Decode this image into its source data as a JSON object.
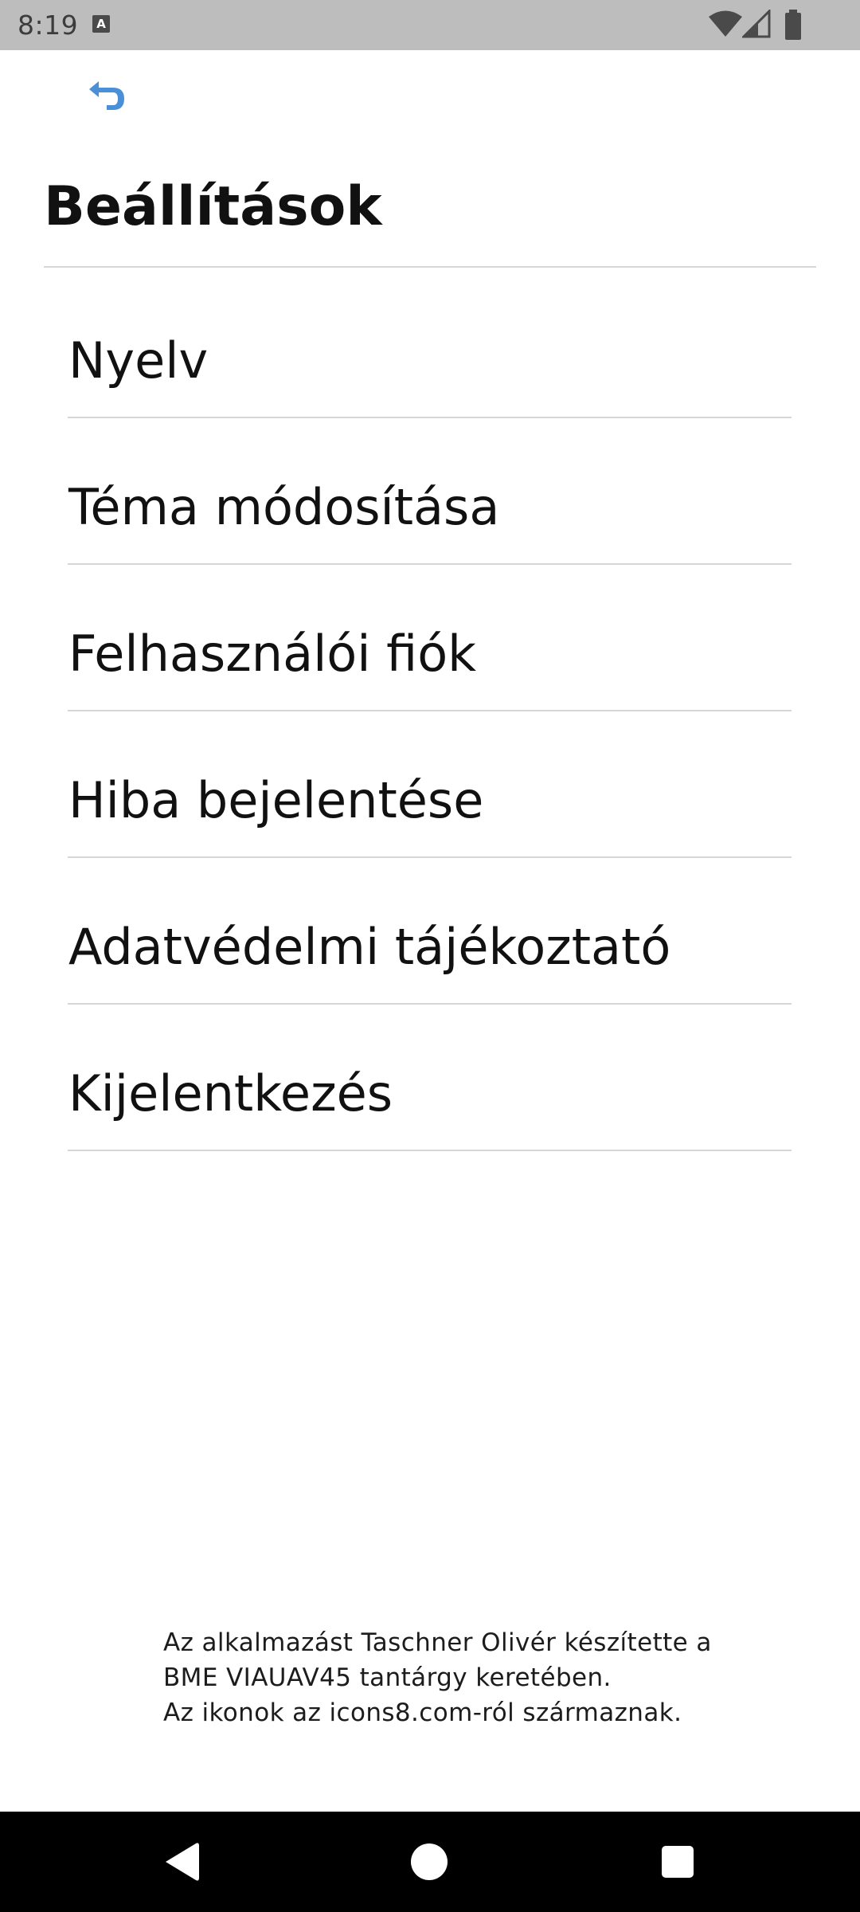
{
  "status_bar": {
    "time": "8:19",
    "notification_icon": "A",
    "icons": [
      "wifi-icon",
      "cellular-signal-icon",
      "battery-icon"
    ]
  },
  "header": {
    "back_icon": "undo-arrow-icon",
    "title": "Beállítások"
  },
  "menu": {
    "items": [
      {
        "label": "Nyelv"
      },
      {
        "label": "Téma módosítása"
      },
      {
        "label": "Felhasználói fiók"
      },
      {
        "label": "Hiba bejelentése"
      },
      {
        "label": "Adatvédelmi tájékoztató"
      },
      {
        "label": "Kijelentkezés"
      }
    ]
  },
  "footer": {
    "line1": "Az alkalmazást Taschner Olivér készítette a",
    "line2": "BME VIAUAV45 tantárgy keretében.",
    "line3": "Az ikonok az icons8.com-ról származnak."
  },
  "colors": {
    "status_bar_bg": "#bdbdbd",
    "accent_icon": "#4a90d9",
    "divider": "#d6d6d6",
    "nav_bar_bg": "#000000"
  }
}
